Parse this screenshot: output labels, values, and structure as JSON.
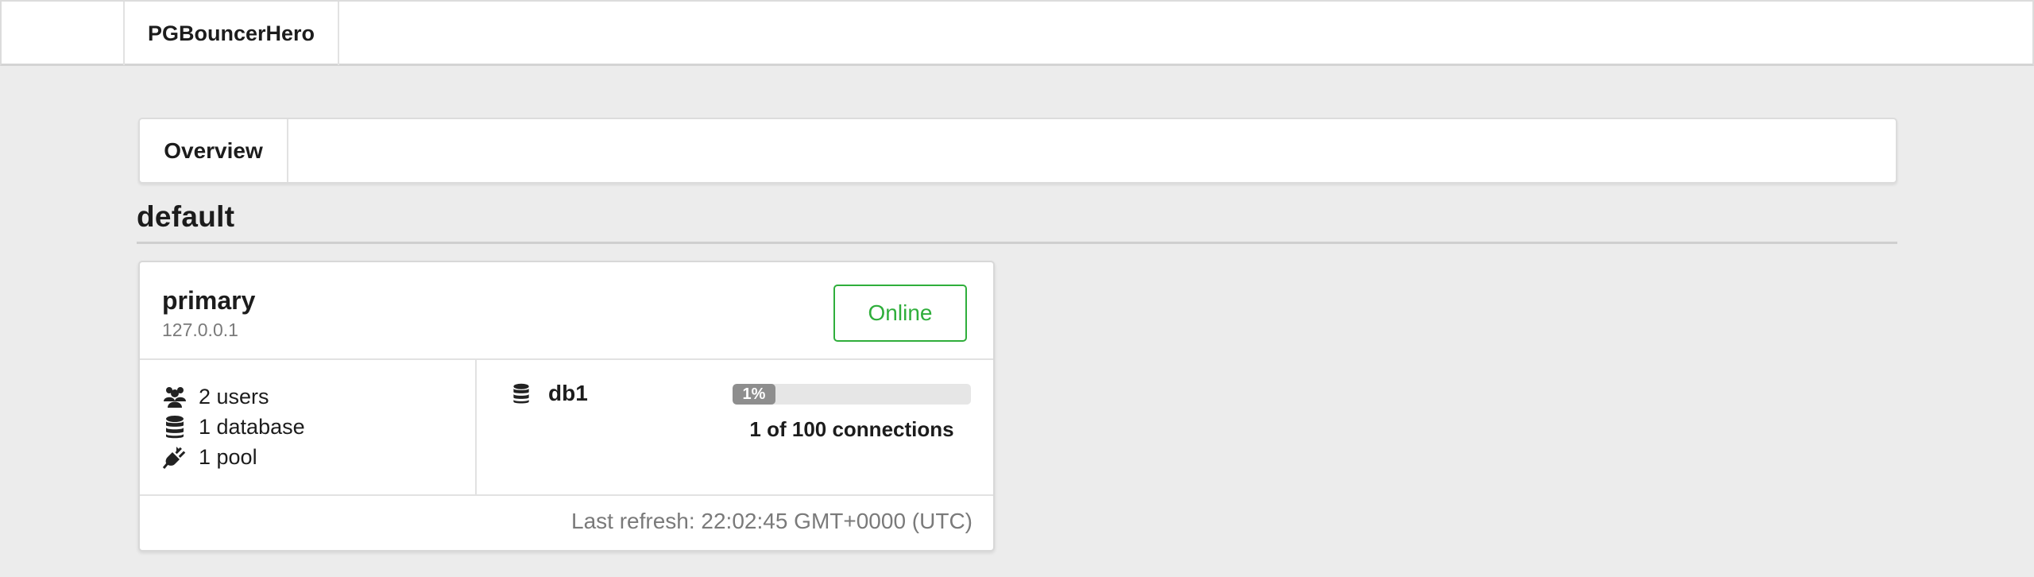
{
  "app": {
    "title": "PGBouncerHero"
  },
  "tabs": [
    {
      "label": "Overview"
    }
  ],
  "group": {
    "name": "default"
  },
  "server": {
    "name": "primary",
    "host": "127.0.0.1",
    "status": "Online",
    "status_color": "#2fae3b",
    "stats": {
      "users": "2 users",
      "databases": "1 database",
      "pools": "1 pool"
    },
    "database": {
      "name": "db1",
      "usage_percent": 1,
      "usage_label": "1%",
      "connections_text": "1 of 100 connections"
    },
    "last_refresh": "Last refresh: 22:02:45 GMT+0000 (UTC)"
  },
  "icons": {
    "users": "users-icon",
    "database": "database-icon",
    "pool": "plug-icon"
  }
}
